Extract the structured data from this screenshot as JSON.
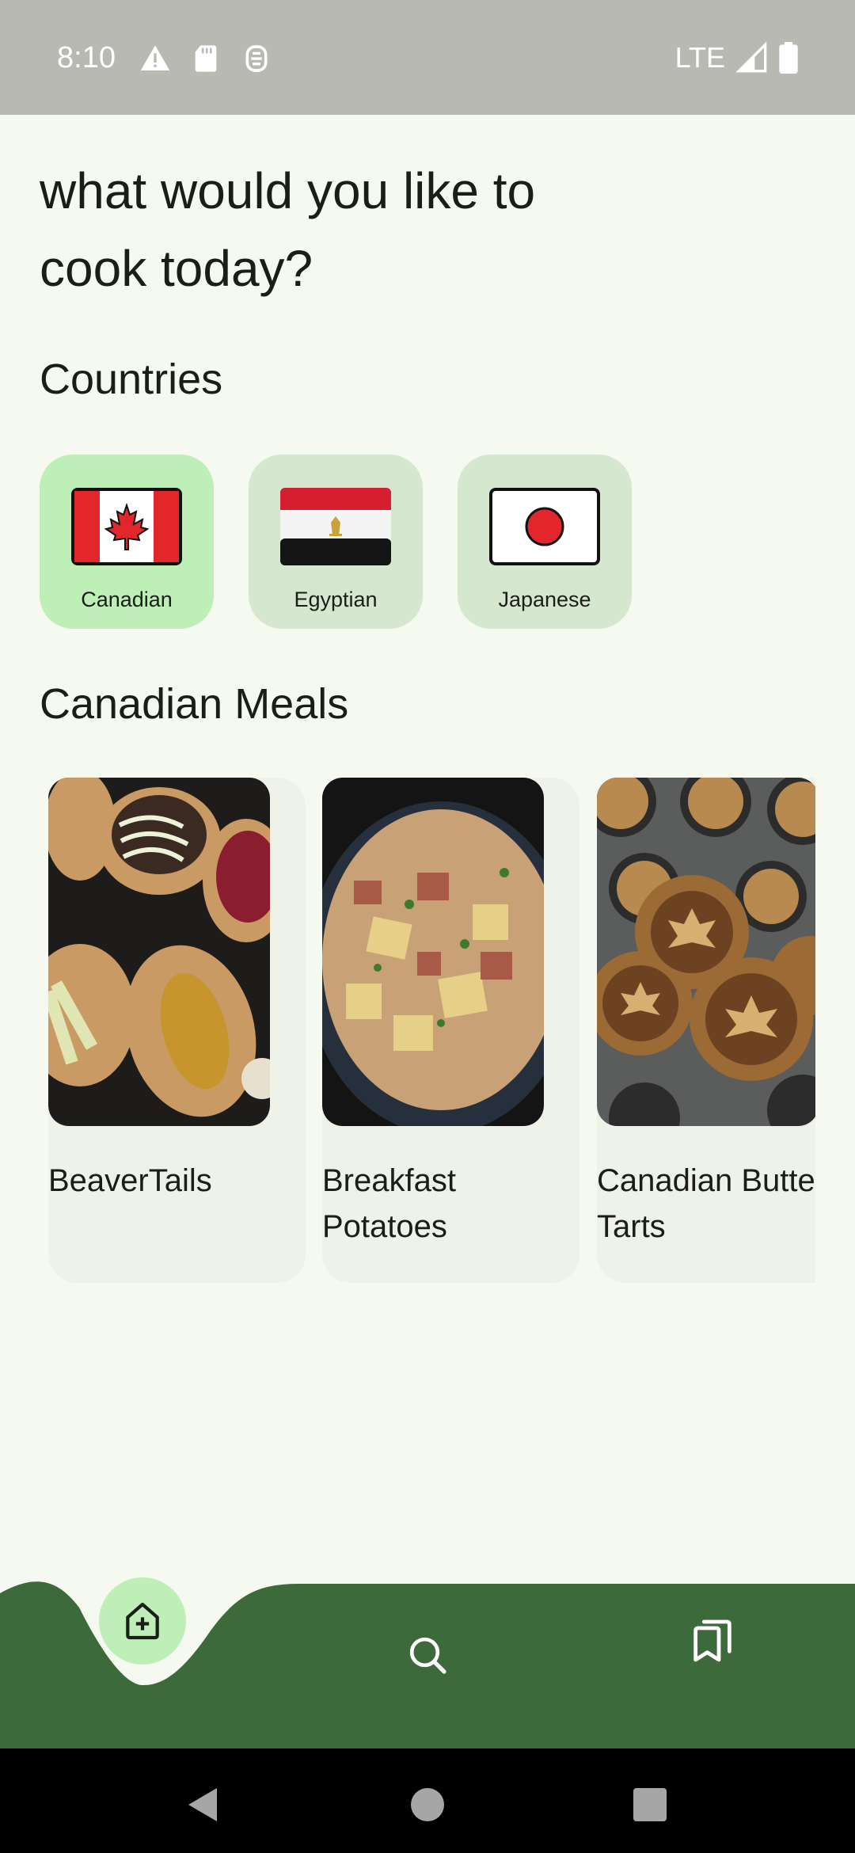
{
  "status_bar": {
    "time": "8:10",
    "network": "LTE",
    "icons": [
      "alert-icon",
      "sd-card-icon",
      "sim-icon",
      "signal-icon",
      "battery-icon"
    ]
  },
  "headline": "what would you like to cook today?",
  "countries": {
    "title": "Countries",
    "items": [
      {
        "label": "Canadian",
        "selected": true,
        "flag": "canada-flag-icon"
      },
      {
        "label": "Egyptian",
        "selected": false,
        "flag": "egypt-flag-icon"
      },
      {
        "label": "Japanese",
        "selected": false,
        "flag": "japan-flag-icon"
      }
    ]
  },
  "meals": {
    "title": "Canadian Meals",
    "items": [
      {
        "name_line1": "BeaverTails",
        "name_line2": ""
      },
      {
        "name_line1": "Breakfast",
        "name_line2": "Potatoes"
      },
      {
        "name_line1": "Canadian Butter",
        "name_line2": "Tarts"
      }
    ]
  },
  "bottom_nav": {
    "items": [
      "home-add-icon",
      "search-icon",
      "saved-recipes-icon"
    ],
    "active": "home-add-icon"
  },
  "colors": {
    "background": "#f5f9ef",
    "nav_green": "#3c6a3b",
    "selected_chip": "#bdefb6",
    "chip": "#d6e7cf",
    "card": "#eff2e9"
  }
}
